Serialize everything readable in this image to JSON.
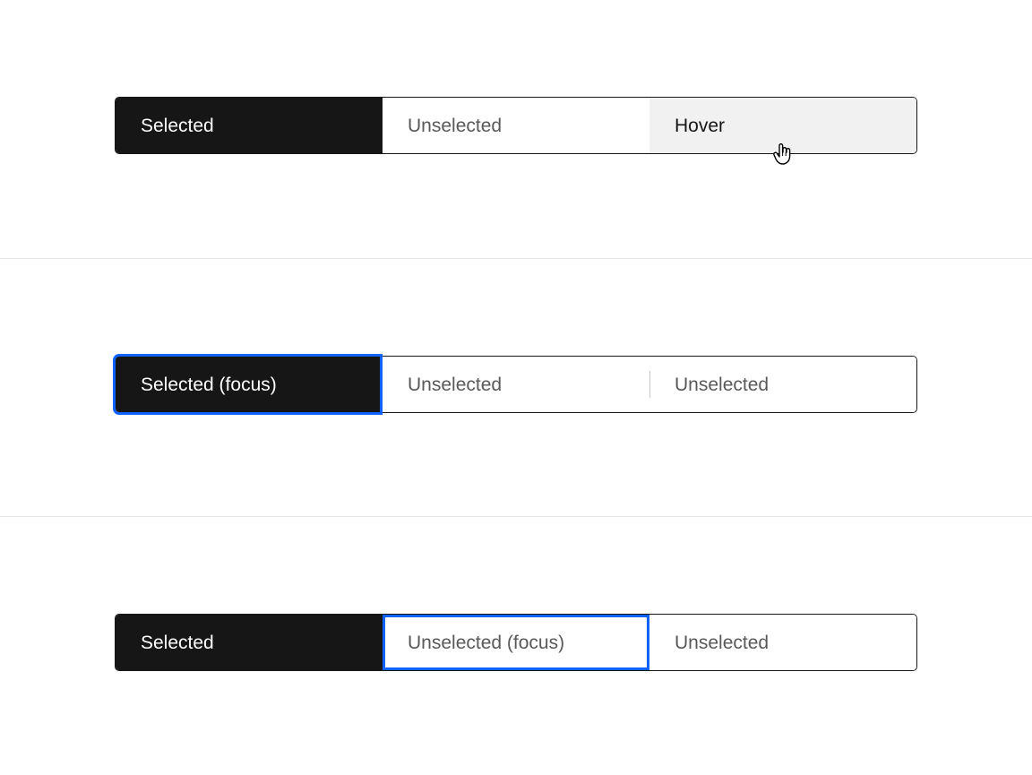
{
  "example1": {
    "segments": [
      {
        "label": "Selected"
      },
      {
        "label": "Unselected"
      },
      {
        "label": "Hover"
      }
    ]
  },
  "example2": {
    "segments": [
      {
        "label": "Selected (focus)"
      },
      {
        "label": "Unselected"
      },
      {
        "label": "Unselected"
      }
    ]
  },
  "example3": {
    "segments": [
      {
        "label": "Selected"
      },
      {
        "label": "Unselected (focus)"
      },
      {
        "label": "Unselected"
      }
    ]
  }
}
